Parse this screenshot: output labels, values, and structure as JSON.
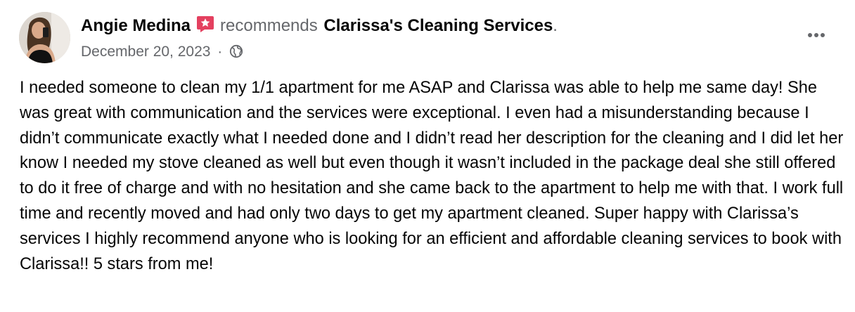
{
  "post": {
    "author": "Angie Medina",
    "recommends_text": "recommends",
    "business": "Clarissa's Cleaning Services",
    "period": ".",
    "date": "December 20, 2023",
    "separator": "·",
    "audience_icon": "globe-icon",
    "menu_icon": "more-options-icon",
    "recommend_badge_icon": "recommendation-star-badge-icon",
    "body": "I needed someone to clean my 1/1 apartment for me ASAP and Clarissa was able to help me same day! She was great with communication and the services were exceptional. I even had a misunderstanding because I didn’t communicate exactly what I needed done and I didn’t read her description for the cleaning and I did let her know I needed my stove cleaned as well but even though it wasn’t included in the package deal she still offered to do it free of charge and with no hesitation and she came back to the apartment to help me with that. I work full time and recently moved and had only two days to get my apartment cleaned. Super happy with Clarissa’s services I highly recommend anyone who is looking for an efficient and affordable cleaning services to book with Clarissa!! 5 stars from me!"
  },
  "colors": {
    "primary_text": "#050505",
    "secondary_text": "#65676b",
    "badge": "#e4405f",
    "background": "#ffffff"
  }
}
